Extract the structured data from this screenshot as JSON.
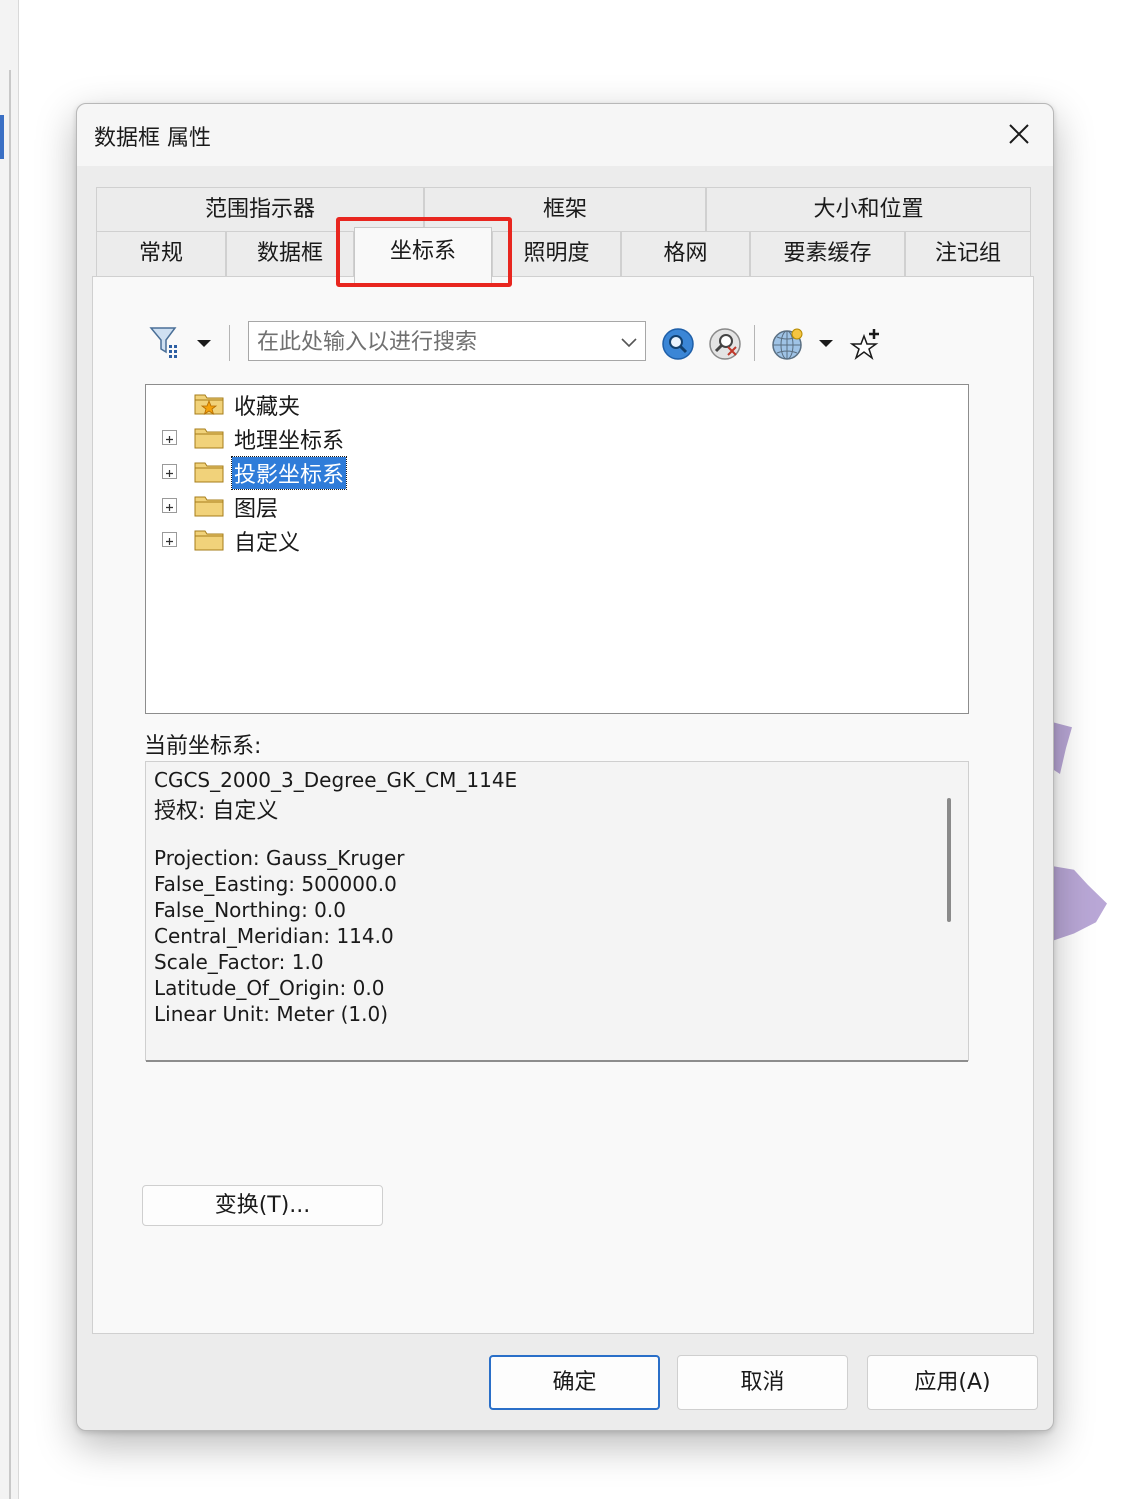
{
  "dialog": {
    "title": "数据框 属性",
    "close_label": "✕"
  },
  "tabs": {
    "row1": [
      "范围指示器",
      "框架",
      "大小和位置"
    ],
    "row2": [
      "常规",
      "数据框",
      "坐标系",
      "照明度",
      "格网",
      "要素缓存",
      "注记组"
    ],
    "active": "坐标系"
  },
  "toolbar": {
    "search_placeholder": "在此处输入以进行搜索",
    "icons": [
      "filter-icon",
      "dropdown-arrow-icon",
      "search-icon",
      "clear-search-icon",
      "globe-icon",
      "dropdown-arrow-icon",
      "add-favorite-icon"
    ]
  },
  "tree": {
    "items": [
      {
        "label": "收藏夹",
        "icon": "favorites-folder-icon",
        "expandable": false,
        "selected": false
      },
      {
        "label": "地理坐标系",
        "icon": "folder-icon",
        "expandable": true,
        "selected": false
      },
      {
        "label": "投影坐标系",
        "icon": "folder-icon",
        "expandable": true,
        "selected": true
      },
      {
        "label": "图层",
        "icon": "folder-icon",
        "expandable": true,
        "selected": false
      },
      {
        "label": "自定义",
        "icon": "folder-icon",
        "expandable": true,
        "selected": false
      }
    ]
  },
  "current": {
    "label": "当前坐标系:",
    "name": "CGCS_2000_3_Degree_GK_CM_114E",
    "authority": "授权: 自定义",
    "params": [
      "Projection: Gauss_Kruger",
      "False_Easting: 500000.0",
      "False_Northing: 0.0",
      "Central_Meridian: 114.0",
      "Scale_Factor: 1.0",
      "Latitude_Of_Origin: 0.0",
      "Linear Unit: Meter (1.0)"
    ]
  },
  "buttons": {
    "transform": "变换(T)...",
    "ok": "确定",
    "cancel": "取消",
    "apply": "应用(A)"
  },
  "colors": {
    "selection": "#2f7cd9",
    "highlight_box": "#e8261f",
    "primary_border": "#2a6fc8"
  }
}
